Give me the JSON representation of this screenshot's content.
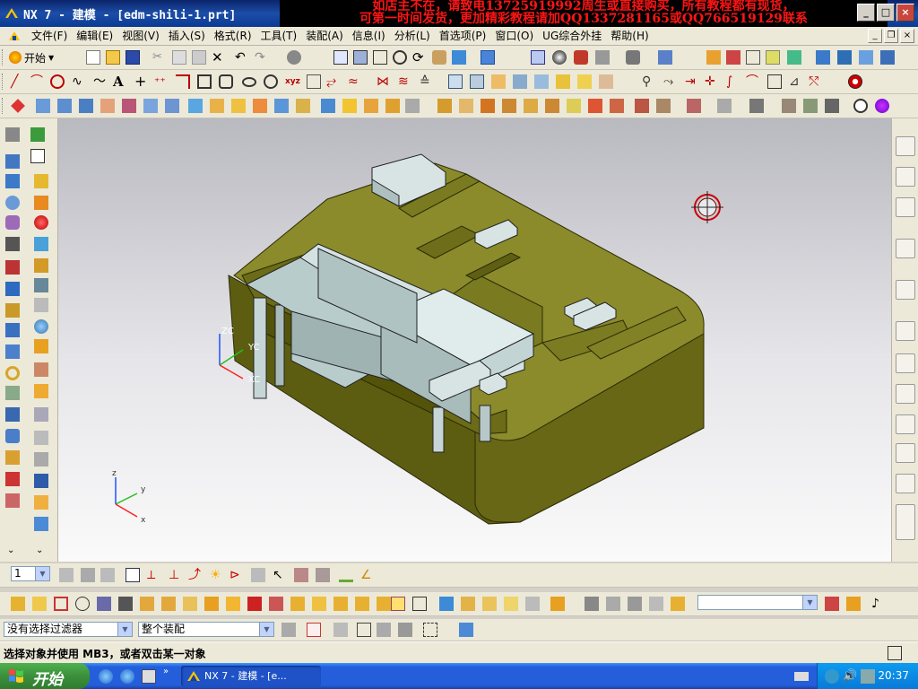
{
  "window": {
    "title": "NX 7 - 建模 - [edm-shili-1.prt]",
    "controls": [
      "_",
      "□",
      "×"
    ]
  },
  "banner": {
    "line1": "如店主不在，请致电13725919992周生或直接购买，所有教程都有现货，",
    "line2": "可第一时间发货，更加精彩教程请加QQ1337281165或QQ766519129联系"
  },
  "menu": {
    "items": [
      "文件(F)",
      "编辑(E)",
      "视图(V)",
      "插入(S)",
      "格式(R)",
      "工具(T)",
      "装配(A)",
      "信息(I)",
      "分析(L)",
      "首选项(P)",
      "窗口(O)",
      "UG综合外挂",
      "帮助(H)"
    ]
  },
  "toolbar": {
    "start_label": "开始"
  },
  "viewport": {
    "wcs_labels": {
      "x": "XC",
      "y": "YC",
      "z": "ZC"
    },
    "triad_labels": {
      "x": "x",
      "y": "y",
      "z": "z"
    }
  },
  "layer": {
    "value": "1"
  },
  "selection": {
    "filter_value": "没有选择过滤器",
    "scope_value": "整个装配"
  },
  "status": {
    "message": "选择对象并使用 MB3，或者双击某一对象"
  },
  "taskbar": {
    "start_label": "开始",
    "task_label": "NX 7 - 建模 - [e...",
    "clock": "20:37"
  },
  "colors": {
    "mold_top": "#8a8a2c",
    "mold_side": "#5e5e14",
    "electrode": "#c6d8d8"
  }
}
